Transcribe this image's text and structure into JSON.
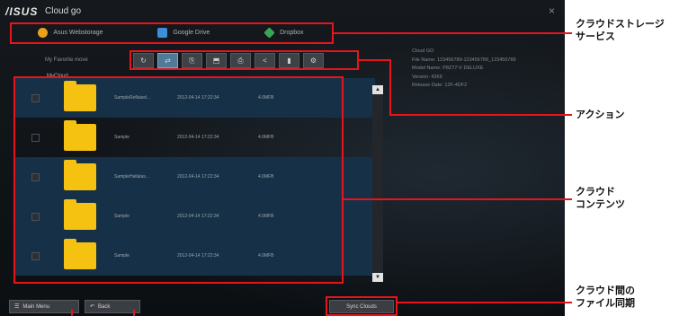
{
  "app": {
    "logo": "/ISUS",
    "title": "Cloud go",
    "close": "×"
  },
  "services": [
    {
      "label": "Asus Webstorage",
      "color": "#e8a21c"
    },
    {
      "label": "Google Drive",
      "color": "#3c8fd8"
    },
    {
      "label": "Dropbox",
      "color": "#3aa655"
    }
  ],
  "favorites_label": "My Favorite move",
  "actions": [
    "↻",
    "⇄",
    "⎘",
    "⬒",
    "⎙",
    "<",
    "▮",
    "⚙"
  ],
  "info": [
    "Cloud GO",
    "File Name: 123456789-123456789_123456789",
    "Model Name: P8Z77-V DELUXE",
    "Version: 4269",
    "Release Date: 12F-4DF2"
  ],
  "breadcrumb": "MyCloud",
  "rows": [
    {
      "name": "SampleReflaisel...",
      "date": "2012-04-14 17:22:34",
      "size": "4.0MFB",
      "checked": true
    },
    {
      "name": "Sample",
      "date": "2012-04-14 17:22:34",
      "size": "4.0MFB",
      "checked": false
    },
    {
      "name": "SampleHallalas...",
      "date": "2012-04-14 17:22:34",
      "size": "4.0MFB",
      "checked": true
    },
    {
      "name": "Sample",
      "date": "2012-04-14 17:22:34",
      "size": "4.0MFB",
      "checked": true
    },
    {
      "name": "Sample",
      "date": "2012-04-14 17:22:34",
      "size": "4.0MFB",
      "checked": true
    }
  ],
  "buttons": {
    "main_menu": "Main Menu",
    "back": "Back",
    "sync": "Sync Clouds"
  },
  "annotations": {
    "services": "クラウドストレージ\nサービス",
    "actions": "アクション",
    "content": "クラウド\nコンテンツ",
    "sync": "クラウド間の\nファイル同期"
  },
  "accent_color": "#e8141c"
}
